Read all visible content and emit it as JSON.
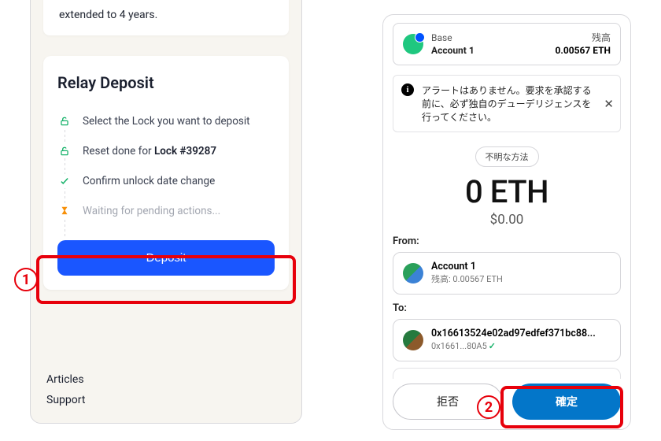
{
  "left": {
    "top_text": "extended to 4 years.",
    "card_title": "Relay Deposit",
    "steps": {
      "s1": "Select the Lock you want to deposit",
      "s2_prefix": "Reset done for ",
      "s2_bold": "Lock #39287",
      "s3": "Confirm unlock date change",
      "s4": "Waiting for pending actions..."
    },
    "deposit_btn": "Deposit",
    "footer": {
      "articles": "Articles",
      "support": "Support"
    }
  },
  "right": {
    "network": "Base",
    "account_name": "Account 1",
    "balance_label": "残高",
    "balance_value": "0.00567 ETH",
    "alert_text": "アラートはありません。要求を承認する前に、必ず独自のデューデリジェンスを行ってください。",
    "method": "不明な方法",
    "amount": "0 ETH",
    "amount_usd": "$0.00",
    "from_label": "From:",
    "from_name": "Account 1",
    "from_sub": "残高: 0.00567 ETH",
    "to_label": "To:",
    "to_addr": "0x16613524e02ad97edfef371bc88...",
    "to_short": "0x1661...80A5",
    "reject": "拒否",
    "confirm": "確定"
  },
  "markers": {
    "m1": "1",
    "m2": "2"
  }
}
